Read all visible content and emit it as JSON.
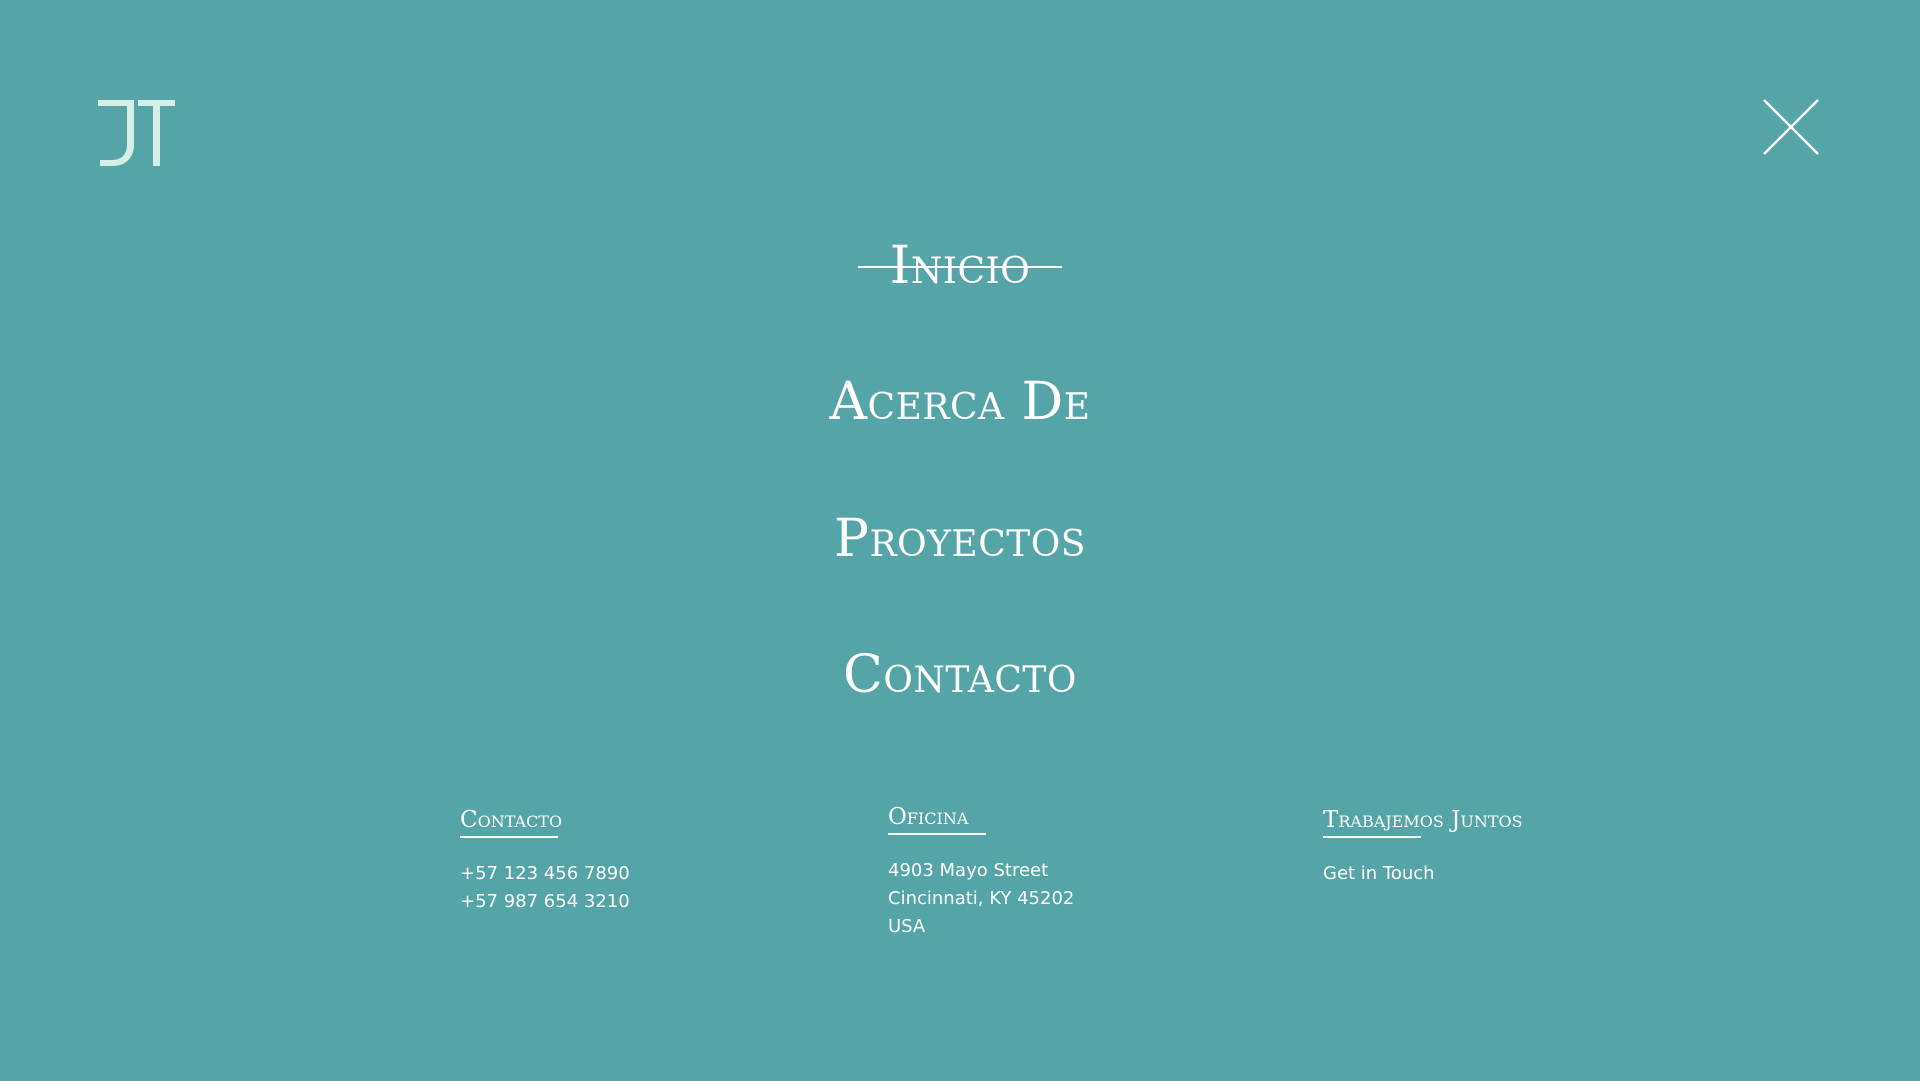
{
  "brand": {
    "logo_text": "JT",
    "logo_color": "#d6efe6",
    "background_color": "#55a4a7",
    "text_color": "#ffffff"
  },
  "header": {
    "close_icon": "close-icon"
  },
  "main_nav": {
    "items": [
      {
        "label": "Inicio",
        "active": true
      },
      {
        "label": "Acerca De",
        "active": false
      },
      {
        "label": "Proyectos",
        "active": false
      },
      {
        "label": "Contacto",
        "active": false
      }
    ]
  },
  "footer": {
    "contact": {
      "heading": "Contacto",
      "lines": [
        "+57 123 456 7890",
        "+57 987 654 3210"
      ]
    },
    "office": {
      "heading": "Oficina",
      "lines": [
        "4903 Mayo Street",
        "Cincinnati, KY 45202",
        "USA"
      ]
    },
    "work_together": {
      "heading": "Trabajemos Juntos",
      "link": "Get in Touch"
    }
  }
}
